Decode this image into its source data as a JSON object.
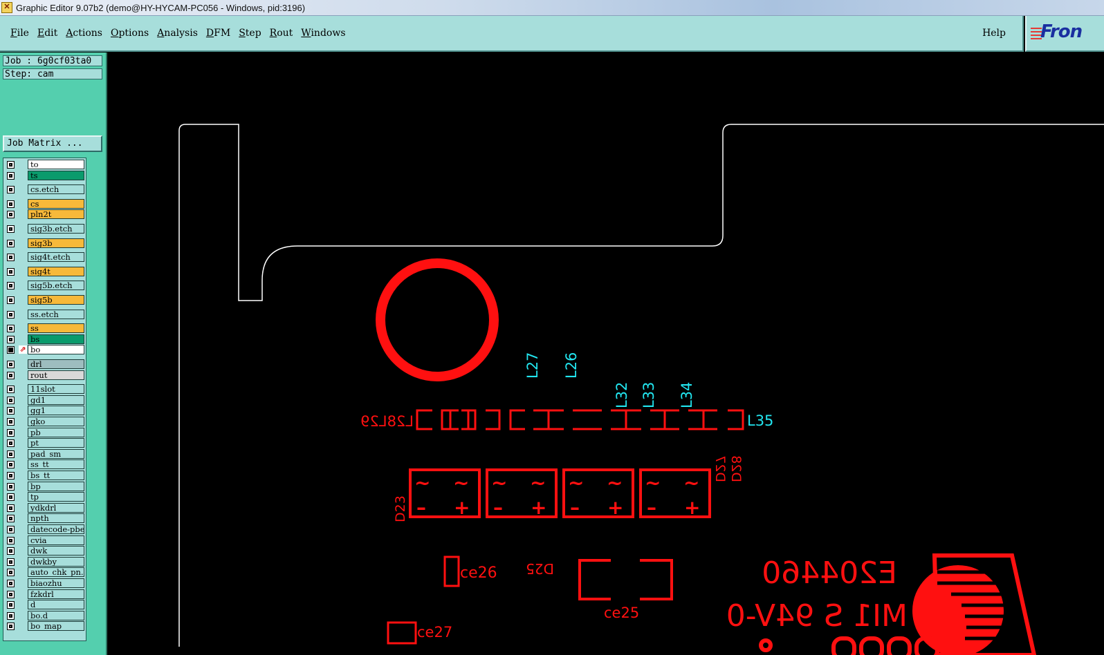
{
  "window": {
    "title": "Graphic Editor 9.07b2 (demo@HY-HYCAM-PC056 - Windows, pid:3196)"
  },
  "menubar": {
    "items": [
      {
        "first": "F",
        "rest": "ile"
      },
      {
        "first": "E",
        "rest": "dit"
      },
      {
        "first": "A",
        "rest": "ctions"
      },
      {
        "first": "O",
        "rest": "ptions"
      },
      {
        "first": "A",
        "rest": "nalysis"
      },
      {
        "first": "D",
        "rest": "FM"
      },
      {
        "first": "S",
        "rest": "tep"
      },
      {
        "first": "R",
        "rest": "out"
      },
      {
        "first": "W",
        "rest": "indows"
      }
    ],
    "help": "Help"
  },
  "logo": {
    "text": "Fron"
  },
  "panel": {
    "job": "Job : 6g0cf03ta0",
    "step": "Step: cam",
    "job_matrix": "Job Matrix ..."
  },
  "layers": [
    {
      "name": "to",
      "color": "#ffffff"
    },
    {
      "name": "ts",
      "color": "#0a9b6c"
    },
    {
      "name": "cs.etch",
      "color": "#a7dedb"
    },
    {
      "name": "cs",
      "color": "#f7b93a"
    },
    {
      "name": "pln2t",
      "color": "#f7b93a"
    },
    {
      "name": "sig3b.etch",
      "color": "#a7dedb"
    },
    {
      "name": "sig3b",
      "color": "#f7b93a"
    },
    {
      "name": "sig4t.etch",
      "color": "#a7dedb"
    },
    {
      "name": "sig4t",
      "color": "#f7b93a"
    },
    {
      "name": "sig5b.etch",
      "color": "#a7dedb"
    },
    {
      "name": "sig5b",
      "color": "#f7b93a"
    },
    {
      "name": "ss.etch",
      "color": "#a7dedb"
    },
    {
      "name": "ss",
      "color": "#f7b93a"
    },
    {
      "name": "bs",
      "color": "#0a9b6c"
    },
    {
      "name": "bo",
      "color": "#ffffff",
      "active": true
    },
    {
      "name": "drl",
      "color": "#9dbdbf"
    },
    {
      "name": "rout",
      "color": "#d9d9d9"
    },
    {
      "name": "11slot",
      "color": "#a7dedb"
    },
    {
      "name": "gd1",
      "color": "#a7dedb"
    },
    {
      "name": "gg1",
      "color": "#a7dedb"
    },
    {
      "name": "gko",
      "color": "#a7dedb"
    },
    {
      "name": "pb",
      "color": "#a7dedb"
    },
    {
      "name": "pt",
      "color": "#a7dedb"
    },
    {
      "name": "pad_sm",
      "color": "#a7dedb"
    },
    {
      "name": "ss_tt",
      "color": "#a7dedb"
    },
    {
      "name": "bs_tt",
      "color": "#a7dedb"
    },
    {
      "name": "bp",
      "color": "#a7dedb"
    },
    {
      "name": "tp",
      "color": "#a7dedb"
    },
    {
      "name": "ydkdrl",
      "color": "#a7dedb"
    },
    {
      "name": "npth",
      "color": "#a7dedb"
    },
    {
      "name": "datecode-pbe",
      "color": "#a7dedb"
    },
    {
      "name": "cvia",
      "color": "#a7dedb"
    },
    {
      "name": "dwk",
      "color": "#a7dedb"
    },
    {
      "name": "dwkby",
      "color": "#a7dedb"
    },
    {
      "name": "auto_chk_pn.",
      "color": "#a7dedb"
    },
    {
      "name": "biaozhu",
      "color": "#a7dedb"
    },
    {
      "name": "fzkdrl",
      "color": "#a7dedb"
    },
    {
      "name": "d",
      "color": "#a7dedb"
    },
    {
      "name": "bo.d",
      "color": "#a7dedb"
    },
    {
      "name": "bo_map",
      "color": "#a7dedb"
    }
  ],
  "pcb": {
    "cyan_labels": [
      "L27",
      "L26",
      "L32",
      "L33",
      "L34",
      "L35"
    ],
    "red_labels": {
      "mirrored_l": "L28L29",
      "d23": "D23",
      "d27": "D27",
      "d28": "D28",
      "ce26": "ce26",
      "d25": "D25",
      "ce25": "ce25",
      "ce27": "ce27",
      "part_no": "E204460",
      "ul_rating": "MI1 S 94V-0"
    },
    "colors": {
      "outline": "#ffffff",
      "silk": "#ff1010",
      "label": "#22e6f0",
      "background": "#000000"
    }
  }
}
